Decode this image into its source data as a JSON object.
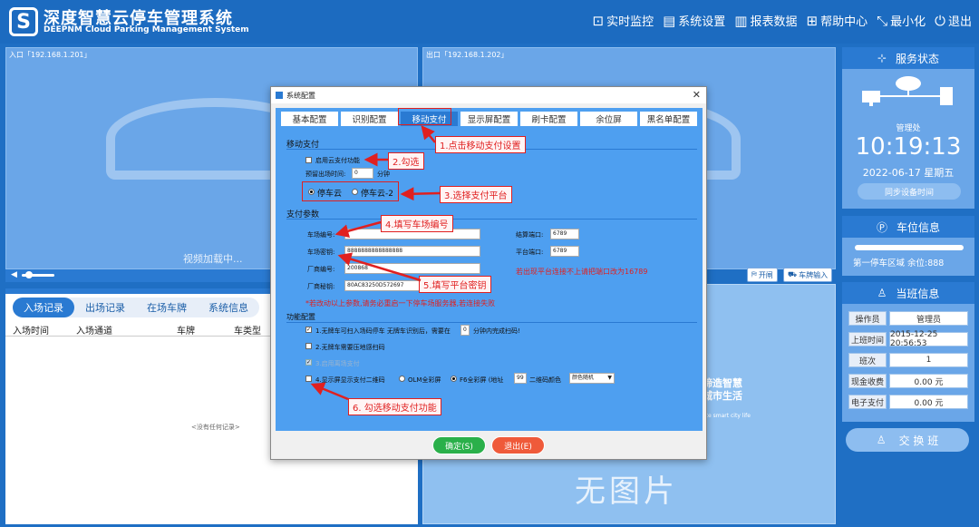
{
  "header": {
    "logo_glyph": "S",
    "title": "深度智慧云停车管理系统",
    "subtitle": "DEEPNM Cloud Parking Management System",
    "nav": [
      {
        "icon": "monitor-icon",
        "glyph": "⊡",
        "label": "实时监控"
      },
      {
        "icon": "settings-icon",
        "glyph": "▤",
        "label": "系统设置"
      },
      {
        "icon": "report-icon",
        "glyph": "▥",
        "label": "报表数据"
      },
      {
        "icon": "help-icon",
        "glyph": "⊞",
        "label": "帮助中心"
      },
      {
        "icon": "minimize-icon",
        "glyph": "⤡",
        "label": "最小化"
      },
      {
        "icon": "power-icon",
        "glyph": "⏻",
        "label": "退出"
      }
    ]
  },
  "cameras": {
    "entry_label": "入口「192.168.1.201」",
    "exit_label": "出口「192.168.1.202」",
    "loading": "视频加载中...",
    "open_btn": "开闸",
    "plate_btn": "车牌输入"
  },
  "records": {
    "tabs": [
      "入场记录",
      "出场记录",
      "在场车牌",
      "系统信息"
    ],
    "columns": [
      "入场时间",
      "入场通道",
      "车牌",
      "车类型"
    ],
    "empty": "<没有任何记录>"
  },
  "no_image": {
    "text": "无图片",
    "slogan_line1": "缔造智慧",
    "slogan_line2": "城市生活",
    "slogan_sub": "ate smart city life"
  },
  "sidebar": {
    "service": {
      "title": "服务状态",
      "manager": "管理处",
      "time": "10:19:13",
      "date": "2022-06-17 星期五",
      "sync_btn": "同步设备时间"
    },
    "parking": {
      "title": "车位信息",
      "text": "第一停车区域 余位:888"
    },
    "duty": {
      "title": "当班信息",
      "rows": [
        {
          "key": "操作员",
          "value": "管理员"
        },
        {
          "key": "上班时间",
          "value": "2015-12-25 20:56:53"
        },
        {
          "key": "班次",
          "value": "1"
        },
        {
          "key": "现金收费",
          "value": "0.00 元"
        },
        {
          "key": "电子支付",
          "value": "0.00 元"
        }
      ]
    },
    "shift_btn": "交 换 班"
  },
  "dialog": {
    "title": "系统配置",
    "tabs": [
      "基本配置",
      "识别配置",
      "移动支付",
      "显示屏配置",
      "刷卡配置",
      "余位屏",
      "黑名单配置"
    ],
    "active_tab": 2,
    "section_pay": "移动支付",
    "enable_cloud": "启用云支付功能",
    "reserve_label": "预留出场时间:",
    "reserve_value": "0",
    "reserve_unit": "分钟",
    "platform_1": "停车云",
    "platform_2": "停车云-2",
    "section_params": "支付参数",
    "lot_no_label": "车场编号:",
    "lot_no_value": "",
    "lot_key_label": "车场密钥:",
    "lot_key_value": "8888888888888888",
    "vendor_no_label": "厂商编号:",
    "vendor_no_value": "200868",
    "vendor_key_label": "厂商秘钥:",
    "vendor_key_value": "80AC83250D572697",
    "settle_port_label": "结算端口:",
    "settle_port_value": "6789",
    "platform_port_label": "平台端口:",
    "platform_port_value": "6789",
    "port_hint": "若出现平台连接不上请把端口改为16789",
    "restart_hint": "*若改动以上参数,请务必重启一下停车场服务器,若连接失败",
    "section_func": "功能配置",
    "func1": "1.无牌车可扫入场码停车  无牌车识别后，需要在",
    "func1_value": "0",
    "func1_tail": "分钟内完成扫码!",
    "func2": "2.无牌车需要压地感扫码",
    "func3": "3.启用离场支付",
    "func4": "4.显示屏显示支付二维码",
    "olm": "OLM全彩屏",
    "f6": "F6全彩屏 (地址",
    "f6_addr": "99",
    "qr_color_label": "二维码颜色",
    "qr_color_value": "颜色随机",
    "ok": "确定(S)",
    "exit": "退出(E)"
  },
  "annotations": [
    "1.点击移动支付设置",
    "2.勾选",
    "3.选择支付平台",
    "4.填写车场编号",
    "5.填写平台密钥",
    "6. 勾选移动支付功能"
  ],
  "colors": {
    "header": "#1c6bc0",
    "accent": "#2a7ad2",
    "annotation": "#e02020",
    "ok": "#2ab04a",
    "exit": "#ef5a3a"
  }
}
